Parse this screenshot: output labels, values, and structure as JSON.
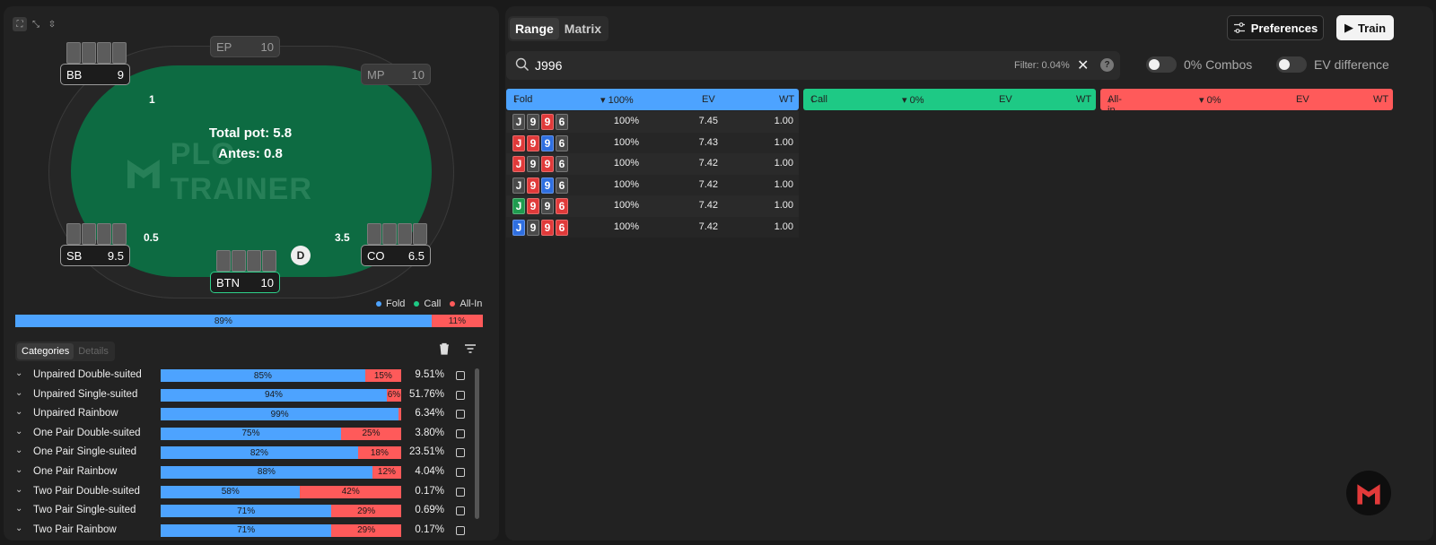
{
  "table": {
    "watermark": "PLO TRAINER",
    "pot_label": "Total pot: 5.8",
    "antes_label": "Antes: 0.8",
    "dealer": "D",
    "seats": {
      "ep": {
        "pos": "EP",
        "stack": "10"
      },
      "bb": {
        "pos": "BB",
        "stack": "9"
      },
      "mp": {
        "pos": "MP",
        "stack": "10"
      },
      "sb": {
        "pos": "SB",
        "stack": "9.5"
      },
      "co": {
        "pos": "CO",
        "stack": "6.5"
      },
      "btn": {
        "pos": "BTN",
        "stack": "10"
      }
    },
    "bets": {
      "bb": "1",
      "sb": "0.5",
      "co": "3.5"
    }
  },
  "legend": [
    {
      "label": "Fold",
      "color": "#4da3ff"
    },
    {
      "label": "Call",
      "color": "#1ec985"
    },
    {
      "label": "All-In",
      "color": "#ff5a5a"
    }
  ],
  "action_bar": {
    "fold_pct": 89,
    "fold_label": "89%",
    "allin_pct": 11,
    "allin_label": "11%"
  },
  "colors": {
    "fold": "#4da3ff",
    "call": "#1ec985",
    "allin": "#ff5a5a",
    "spade": "#4a4a4a",
    "heart": "#e03a3a",
    "diamond": "#2f6fe0",
    "club": "#1f9b4f"
  },
  "category_tabs": [
    "Categories",
    "Details"
  ],
  "icons": {
    "delete": "trash-icon",
    "filter": "filter-icon",
    "search": "search-icon",
    "close": "close-icon",
    "help": "help-icon",
    "sliders": "sliders-icon",
    "play": "play-icon"
  },
  "categories": [
    {
      "name": "Unpaired Double-suited",
      "fold": 85,
      "fold_label": "85%",
      "allin": 15,
      "allin_label": "15%",
      "pct": "9.51%"
    },
    {
      "name": "Unpaired Single-suited",
      "fold": 94,
      "fold_label": "94%",
      "allin": 6,
      "allin_label": "6%",
      "pct": "51.76%"
    },
    {
      "name": "Unpaired Rainbow",
      "fold": 99,
      "fold_label": "99%",
      "allin": 1,
      "allin_label": "",
      "pct": "6.34%"
    },
    {
      "name": "One Pair Double-suited",
      "fold": 75,
      "fold_label": "75%",
      "allin": 25,
      "allin_label": "25%",
      "pct": "3.80%"
    },
    {
      "name": "One Pair Single-suited",
      "fold": 82,
      "fold_label": "82%",
      "allin": 18,
      "allin_label": "18%",
      "pct": "23.51%"
    },
    {
      "name": "One Pair Rainbow",
      "fold": 88,
      "fold_label": "88%",
      "allin": 12,
      "allin_label": "12%",
      "pct": "4.04%"
    },
    {
      "name": "Two Pair Double-suited",
      "fold": 58,
      "fold_label": "58%",
      "allin": 42,
      "allin_label": "42%",
      "pct": "0.17%"
    },
    {
      "name": "Two Pair Single-suited",
      "fold": 71,
      "fold_label": "71%",
      "allin": 29,
      "allin_label": "29%",
      "pct": "0.69%"
    },
    {
      "name": "Two Pair Rainbow",
      "fold": 71,
      "fold_label": "71%",
      "allin": 29,
      "allin_label": "29%",
      "pct": "0.17%"
    }
  ],
  "right": {
    "view_tabs": [
      "Range",
      "Matrix"
    ],
    "preferences_label": "Preferences",
    "train_label": "Train",
    "search_value": "J996",
    "filter_text": "Filter: 0.04%",
    "help_glyph": "?",
    "combos_toggle": "0% Combos",
    "ev_toggle": "EV difference",
    "columns": [
      {
        "action": "Fold",
        "pct": "▾ 100%",
        "ev": "EV",
        "wt": "WT"
      },
      {
        "action": "Call",
        "pct": "▾ 0%",
        "ev": "EV",
        "wt": "WT"
      },
      {
        "action": "All-in",
        "pct": "▾ 0%",
        "ev": "EV",
        "wt": "WT"
      }
    ],
    "fold_hands": [
      {
        "cards": [
          {
            "r": "J",
            "s": "spade"
          },
          {
            "r": "9",
            "s": "spade"
          },
          {
            "r": "9",
            "s": "heart"
          },
          {
            "r": "6",
            "s": "spade"
          }
        ],
        "pct": "100%",
        "ev": "7.45",
        "wt": "1.00"
      },
      {
        "cards": [
          {
            "r": "J",
            "s": "heart"
          },
          {
            "r": "9",
            "s": "heart"
          },
          {
            "r": "9",
            "s": "diamond"
          },
          {
            "r": "6",
            "s": "spade"
          }
        ],
        "pct": "100%",
        "ev": "7.43",
        "wt": "1.00"
      },
      {
        "cards": [
          {
            "r": "J",
            "s": "heart"
          },
          {
            "r": "9",
            "s": "spade"
          },
          {
            "r": "9",
            "s": "heart"
          },
          {
            "r": "6",
            "s": "spade"
          }
        ],
        "pct": "100%",
        "ev": "7.42",
        "wt": "1.00"
      },
      {
        "cards": [
          {
            "r": "J",
            "s": "spade"
          },
          {
            "r": "9",
            "s": "heart"
          },
          {
            "r": "9",
            "s": "diamond"
          },
          {
            "r": "6",
            "s": "spade"
          }
        ],
        "pct": "100%",
        "ev": "7.42",
        "wt": "1.00"
      },
      {
        "cards": [
          {
            "r": "J",
            "s": "club"
          },
          {
            "r": "9",
            "s": "heart"
          },
          {
            "r": "9",
            "s": "spade"
          },
          {
            "r": "6",
            "s": "heart"
          }
        ],
        "pct": "100%",
        "ev": "7.42",
        "wt": "1.00"
      },
      {
        "cards": [
          {
            "r": "J",
            "s": "diamond"
          },
          {
            "r": "9",
            "s": "spade"
          },
          {
            "r": "9",
            "s": "heart"
          },
          {
            "r": "6",
            "s": "heart"
          }
        ],
        "pct": "100%",
        "ev": "7.42",
        "wt": "1.00"
      }
    ]
  }
}
